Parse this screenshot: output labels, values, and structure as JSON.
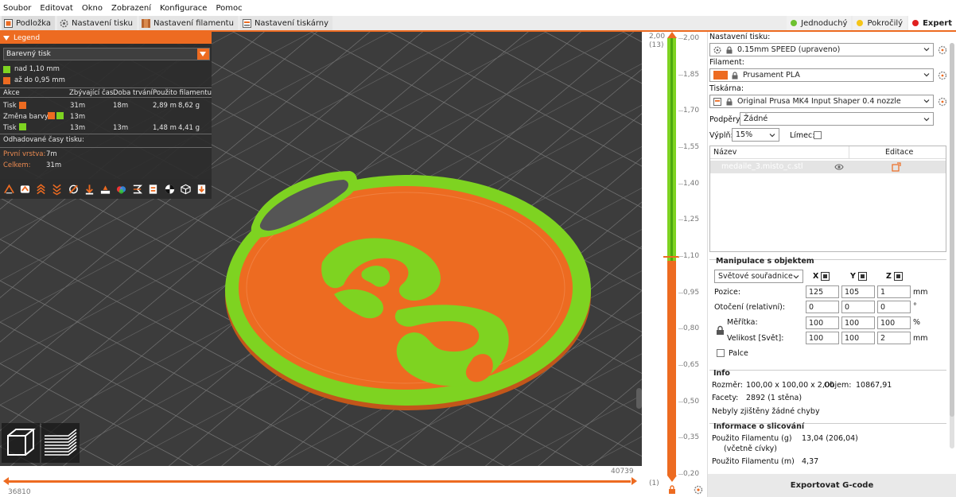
{
  "menu": [
    "Soubor",
    "Editovat",
    "Okno",
    "Zobrazení",
    "Konfigurace",
    "Pomoc"
  ],
  "tabs": [
    {
      "label": "Podložka",
      "icon": "plater-icon",
      "active": true
    },
    {
      "label": "Nastavení tisku",
      "icon": "print-settings-icon"
    },
    {
      "label": "Nastavení filamentu",
      "icon": "filament-icon"
    },
    {
      "label": "Nastavení tiskárny",
      "icon": "printer-icon"
    }
  ],
  "modes": [
    {
      "label": "Jednoduchý",
      "color": "#6dc12f"
    },
    {
      "label": "Pokročilý",
      "color": "#f5c518"
    },
    {
      "label": "Expert",
      "color": "#e0201f",
      "active": true
    }
  ],
  "legend": {
    "title": "Legend",
    "view_type": "Barevný tisk",
    "ranges": [
      {
        "label": "nad 1,10 mm",
        "color": "#7ed321"
      },
      {
        "label": "až do 0,95 mm",
        "color": "#ed6b21"
      }
    ],
    "columns": [
      "Akce",
      "Zbývající čas",
      "Doba trvání",
      "Použito filamentu"
    ],
    "rows": [
      {
        "action": "Tisk",
        "colors": [
          "#ed6b21"
        ],
        "remaining": "31m",
        "duration": "18m",
        "length": "2,89 m",
        "weight": "8,62 g"
      },
      {
        "action": "Změna barvy",
        "colors": [
          "#ed6b21",
          "#7ed321"
        ],
        "remaining": "13m",
        "duration": "",
        "length": "",
        "weight": ""
      },
      {
        "action": "Tisk",
        "colors": [
          "#7ed321"
        ],
        "remaining": "13m",
        "duration": "13m",
        "length": "1,48 m",
        "weight": "4,41 g"
      }
    ],
    "estimated_title": "Odhadované časy tisku:",
    "first_layer_label": "První vrstva:",
    "first_layer_value": "7m",
    "total_label": "Celkem:",
    "total_value": "31m"
  },
  "hslider": {
    "left_value": "36810",
    "right_value": "40739"
  },
  "vslider": {
    "top_value": "2,00",
    "top_layer": "(13)",
    "bottom_value": "0,20",
    "bottom_layer": "(1)",
    "ticks": [
      "2,00",
      "1,85",
      "1,70",
      "1,55",
      "1,40",
      "1,25",
      "1,10",
      "0,95",
      "0,80",
      "0,65",
      "0,50",
      "0,35",
      "0,20"
    ]
  },
  "panel": {
    "print_settings_label": "Nastavení tisku:",
    "print_profile": "0.15mm SPEED (upraveno)",
    "filament_label": "Filament:",
    "filament": "Prusament PLA",
    "filament_color": "#ed6b21",
    "printer_label": "Tiskárna:",
    "printer": "Original Prusa MK4 Input Shaper 0.4 nozzle",
    "supports_label": "Podpěry:",
    "supports": "Žádné",
    "infill_label": "Výplň:",
    "infill": "15%",
    "brim_label": "Límec:",
    "list_name_header": "Název",
    "list_edit_header": "Editace",
    "object_name": "medaile_3.misto_c.stl",
    "manip_title": "Manipulace s objektem",
    "coord_system": "Světové souřadnice",
    "axes": [
      "X",
      "Y",
      "Z"
    ],
    "position_label": "Pozice:",
    "position": [
      "125",
      "105",
      "1"
    ],
    "position_unit": "mm",
    "rotation_label": "Otočení (relativní):",
    "rotation": [
      "0",
      "0",
      "0"
    ],
    "rotation_unit": "°",
    "scale_label": "Měřítka:",
    "scale": [
      "100",
      "100",
      "100"
    ],
    "scale_unit": "%",
    "size_label": "Velikost [Svět]:",
    "size": [
      "100",
      "100",
      "2"
    ],
    "size_unit": "mm",
    "inches_label": "Palce",
    "info_title": "Info",
    "size_info_label": "Rozměr:",
    "size_info": "100,00 x 100,00 x 2,00",
    "volume_label": "Objem:",
    "volume": "10867,91",
    "facets_label": "Facety:",
    "facets": "2892 (1 stěna)",
    "errors": "Nebyly zjištěny žádné chyby",
    "slice_title": "Informace o slicování",
    "fil_g_label": "Použito Filamentu (g)",
    "fil_g_sub": "(včetně cívky)",
    "fil_g": "13,04 (206,04)",
    "fil_m_label": "Použito Filamentu (m)",
    "fil_m": "4,37",
    "export_label": "Exportovat G-code"
  }
}
